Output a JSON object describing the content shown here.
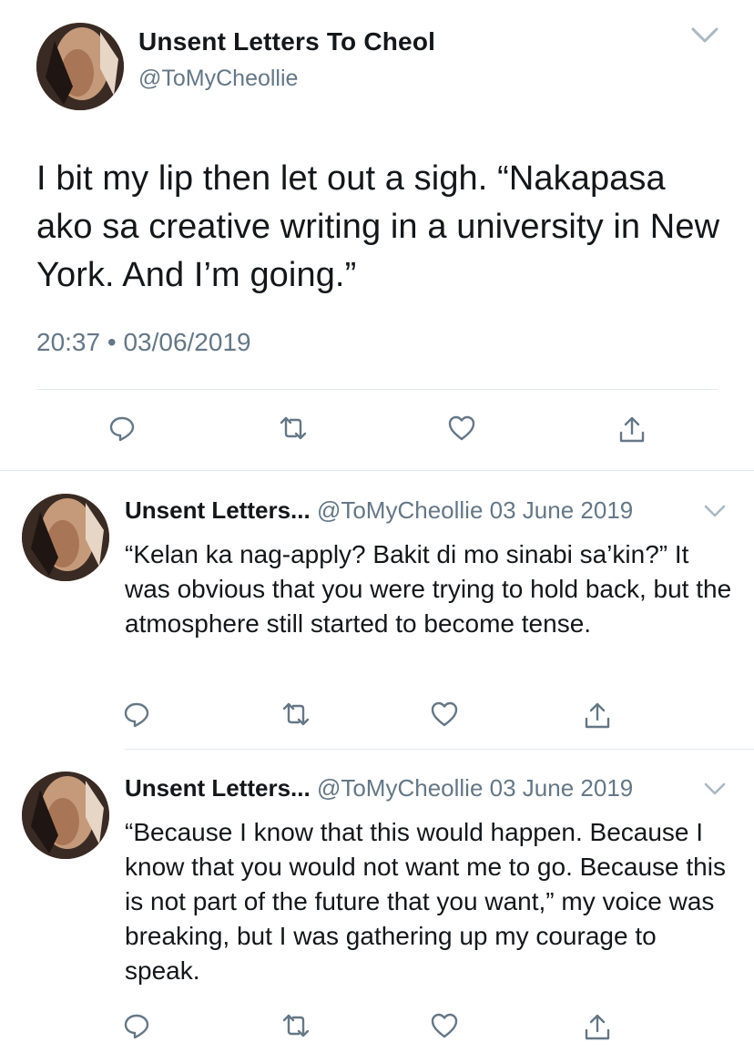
{
  "main_tweet": {
    "display_name": "Unsent Letters To Cheol",
    "handle": "@ToMyCheollie",
    "text": "I bit my lip then let out a sigh. “Nakapasa ako sa creative writing in a university in New York. And I’m going.”",
    "time": "20:37",
    "separator": "•",
    "date": "03/06/2019",
    "actions": [
      "reply-icon",
      "retweet-icon",
      "like-icon",
      "share-icon"
    ]
  },
  "replies": [
    {
      "display_name": "Unsent Letters...",
      "handle": "@ToMyCheollie",
      "date": "03 June 2019",
      "text": "“Kelan ka nag-apply? Bakit di mo sinabi sa’kin?” It was obvious that you were trying to hold back, but the atmosphere still started to become tense."
    },
    {
      "display_name": "Unsent Letters...",
      "handle": "@ToMyCheollie",
      "date": "03 June 2019",
      "text": "“Because I know that this would happen. Because I know that you would not want me to go. Because this is not part of the future that you want,” my voice was breaking, but I was gathering up my courage to speak."
    }
  ],
  "colors": {
    "text_primary": "#14171a",
    "text_secondary": "#657786",
    "divider": "#e1e8ed",
    "chevron": "#aab8c2"
  }
}
